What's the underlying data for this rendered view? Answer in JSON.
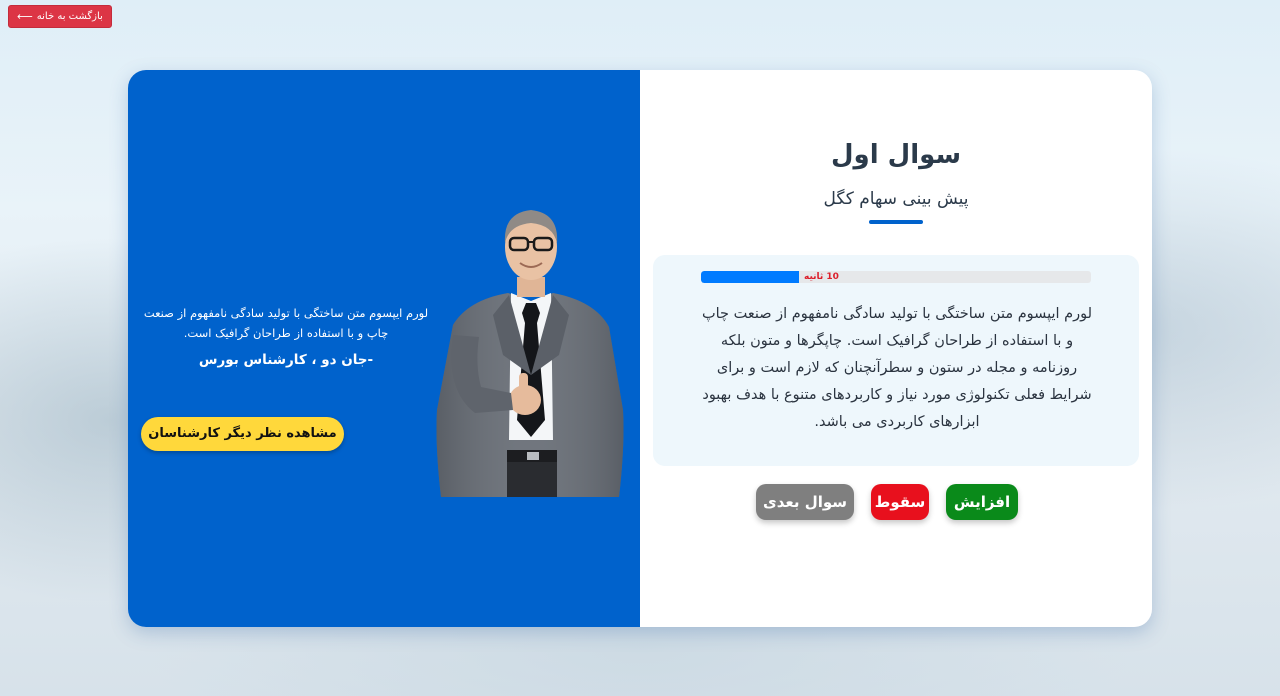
{
  "header": {
    "back_label": "بازگشت به خانه",
    "back_icon": "arrow-left-icon"
  },
  "expert": {
    "quote": "لورم ایپسوم متن ساختگی با تولید سادگی نامفهوم از صنعت چاپ و با استفاده از طراحان گرافیک است.",
    "author": "-جان دو ، کارشناس بورس",
    "more_button": "مشاهده نظر دیگر کارشناسان"
  },
  "question": {
    "title": "سوال اول",
    "subtitle": "پیش بینی سهام کگل",
    "timer_label": "10 ثانیه",
    "timer_progress": 0.25,
    "text": "لورم ایپسوم متن ساختگی با تولید سادگی نامفهوم از صنعت چاپ و با استفاده از طراحان گرافیک است. چاپگرها و متون بلکه روزنامه و مجله در ستون و سطرآنچنان که لازم است و برای شرایط فعلی تکنولوژی مورد نیاز و کاربردهای متنوع با هدف بهبود ابزارهای کاربردی می باشد."
  },
  "actions": {
    "increase_label": "افزایش",
    "decrease_label": "سقوط",
    "next_label": "سوال بعدی"
  },
  "colors": {
    "primary": "#0062cc",
    "increase": "#0a8a1a",
    "decrease": "#e8101d",
    "next": "#7f7f7f",
    "expert_button": "#ffd83b",
    "back_button": "#dc3545"
  }
}
